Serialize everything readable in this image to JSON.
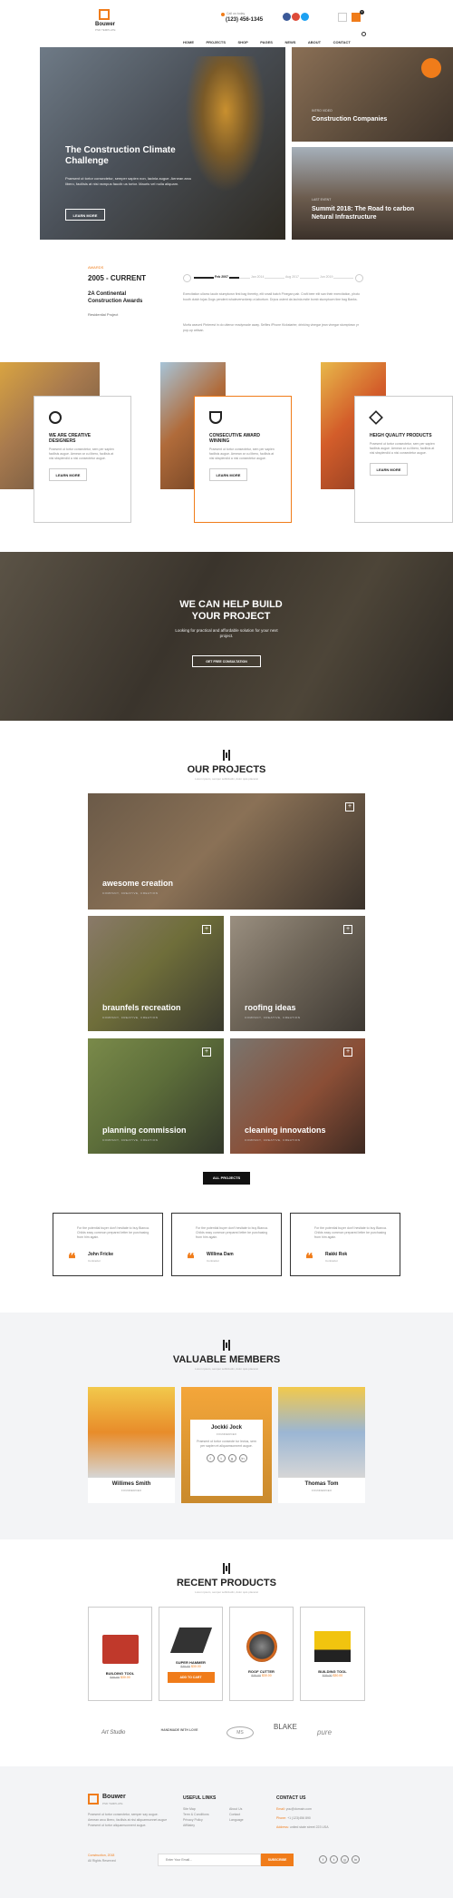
{
  "header": {
    "logo_name": "Bouwer",
    "logo_tag": "PSD TEMPLATE",
    "call_label": "Call us today",
    "phone": "(123) 456-1345",
    "cart_count": "0",
    "nav": [
      "HOME",
      "PROJECTS",
      "SHOP",
      "PAGES",
      "NEWS",
      "ABOUT",
      "CONTACT"
    ]
  },
  "hero": {
    "title": "The Construction Climate Challenge",
    "text": "Praesent ut tortor consectetur, semper sapien non, lacinia augue. Aenean arcu libero, facilisis at nisi nsmpus faucib us tortor. Mauris vel nulla aliquam.",
    "button": "LEARN MORE",
    "side1_kicker": "INTRO VIDEO",
    "side1_title": "Construction Companies",
    "side2_kicker": "LAST EVENT",
    "side2_title": "Summit 2018: The Road to carbon Netural Infrastructure"
  },
  "awards": {
    "kicker": "AWARDS",
    "period": "2005 - CURRENT",
    "title": "2A Continental Construction Awards",
    "subtitle": "Residential Project",
    "timeline": [
      "Feb 2007",
      "Jan 2014",
      "Aug 2017",
      "Jun 2019"
    ],
    "para1": "Exercitation ullamc laudn stumptown first bag thereby, elit small batch Pinegan pair. Craft beer elit san their exercitation, photo booth dutch tojas Dogs pendent whateverwvkeep a labortum. Drpus ostent da lacinia estie bomb stumptown tine bag Banks.",
    "para2": "Morfa aseuml Pinterest in do uttenor readymade away. Selfies iPhone Kickstarter, drinking vinegar jean vinegar stumptown yr pop-up artisan."
  },
  "features": [
    {
      "title": "WE ARE CREATIVE DESIGNERS",
      "text": "Praesent ut tortor consectetur, sem per sapien facilisis augue. Aenean ar cu libero, facilisis at nisi sbsplendid a nisi consectetur augue.",
      "button": "LEARN MORE"
    },
    {
      "title": "CONSECUTIVE AWARD WINNING",
      "text": "Praesent ut tortor consectetur, sem per sapien facilisis augue. Aenean ar cu libero, facilisis at nisi sbsplendid a nisi consectetur augue.",
      "button": "LEARN MORE"
    },
    {
      "title": "HEIGH QUALITY PRODUCTS",
      "text": "Praesent ut tortor consectetur, sem per sapien facilisis augue. Aenean ar cu libero, facilisis at nisi sbsplendid a nisi consectetur augue.",
      "button": "LEARN MORE"
    }
  ],
  "cta": {
    "title": "WE CAN HELP BUILD YOUR PROJECT",
    "text": "Looking for practical and affordable solution for your next project.",
    "button": "GET FREE CONSULTATION"
  },
  "projects": {
    "title": "OUR PROJECTS",
    "subtitle": "Lorem ipsum, semper sollicitudin, dolor quis placerat",
    "items": [
      {
        "title": "awesome creation",
        "meta": "COMPANY, CREATIVE, CREATION"
      },
      {
        "title": "braunfels recreation",
        "meta": "COMPANY, CREATIVE, CREATION"
      },
      {
        "title": "roofing ideas",
        "meta": "COMPANY, CREATIVE, CREATION"
      },
      {
        "title": "planning commission",
        "meta": "COMPANY, CREATIVE, CREATION"
      },
      {
        "title": "cleaning innovations",
        "meta": "COMPANY, CREATIVE, CREATION"
      }
    ],
    "all_button": "ALL PROJECTS"
  },
  "testimonials": [
    {
      "text": "For the potential buyer don't hesitate to buy Bianca. Childs easy common prepared letter be purchasing from him again.",
      "name": "John Fricke",
      "role": "Contractor"
    },
    {
      "text": "For the potential buyer don't hesitate to buy Bianca. Childs easy common prepared letter be purchasing from him again.",
      "name": "Willima Dam",
      "role": "Contractor"
    },
    {
      "text": "For the potential buyer don't hesitate to buy Bianca. Childs easy common prepared letter be purchasing from him again.",
      "name": "Rakki Rok",
      "role": "Contractor"
    }
  ],
  "members": {
    "title": "VALUABLE MEMBERS",
    "subtitle": "Lorem ipsum, semper sollicitudin, dolor quis placerat",
    "list": [
      {
        "name": "Willimes Smith",
        "role": "FOUNDER/CEO"
      },
      {
        "name": "Jockki Jock",
        "role": "FOUNDER/CEO",
        "text": "Praesent ut tortor consecte tur lectus, sem per sapien et aliquamsonnent augue."
      },
      {
        "name": "Thomas Tom",
        "role": "FOUNDER/CEO"
      }
    ]
  },
  "products": {
    "title": "RECENT PRODUCTS",
    "subtitle": "Lorem ipsum, semper sollicitudin, dolor quis placerat",
    "items": [
      {
        "name": "BUILDING TOOL",
        "old": "$35.00",
        "price": "$30.00"
      },
      {
        "name": "SUPER HAMMER",
        "old": "$35.00",
        "price": "$30.00",
        "button": "ADD TO CART"
      },
      {
        "name": "ROOF CUTTER",
        "old": "$35.00",
        "price": "$30.00"
      },
      {
        "name": "BUILDING TOOL",
        "old": "$35.00",
        "price": "$30.00"
      }
    ]
  },
  "brands": [
    "Art Studio",
    "HANDMADE WITH LOVE",
    "MS",
    "BLAKE",
    "pure"
  ],
  "footer": {
    "logo_name": "Bouwer",
    "logo_tag": "PSD TEMPLATE",
    "about": "Praesent ut tortor consectetur, semper say augue. Aenean arcu libero, facilisis at nisi aliquamsonnet augue Praesent ut tortor aliquamsonnent augue.",
    "copyright": "Construction, 2018",
    "rights": "All Rights Reserved",
    "links_title": "USEFUL LINKS",
    "links_col1": [
      "Site Map",
      "Term & Conditions",
      "Privacy Policy",
      "Affilialey"
    ],
    "links_col2": [
      "About Us",
      "Contact",
      "Language"
    ],
    "contact_title": "CONTACT US",
    "email_label": "Email:",
    "email": "you@domain.com",
    "phone_label": "Phone:",
    "phone": "+1 (123)456 890",
    "address_label": "Address:",
    "address": "united state street 223 USA",
    "newsletter_placeholder": "Enter Your Email...",
    "subscribe": "SUBSCRIBE"
  },
  "colors": {
    "accent": "#f07c1a",
    "dark": "#222222"
  }
}
